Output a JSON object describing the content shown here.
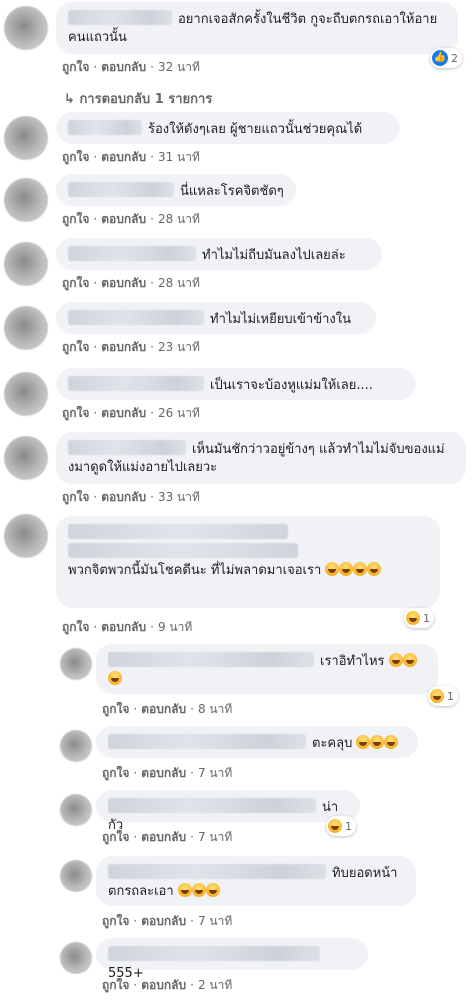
{
  "labels": {
    "like": "ถูกใจ",
    "reply": "ตอบกลับ",
    "dot": "·"
  },
  "replies_link": "การตอบกลับ 1 รายการ",
  "comments": [
    {
      "text": "อยากเจอสักครั้งในชีวิต กูจะถีบตกรถเอาให้อายคนแถวนั้น",
      "time": "32 นาที",
      "reaction_count": "2",
      "reaction": "like-icon"
    },
    {
      "text": "ร้องให้ดังๆเลย ผู้ชายแถวนั้นช่วยคุณได้",
      "time": "31 นาที"
    },
    {
      "text": "นี่แหละโรคจิตชัดๆ",
      "time": "28 นาที"
    },
    {
      "text": "ทำไมไม่ถีบมันลงไปเลยล่ะ",
      "time": "28 นาที"
    },
    {
      "text": "ทำไมไม่เหยียบเข้าข้างใน",
      "time": "23 นาที"
    },
    {
      "text": "เป็นเราจะบ้องหูแม่มให้เลย....",
      "time": "26 นาที"
    },
    {
      "text": "เห็นมันชักว่าวอยู่ข้างๆ แล้วทำไมไม่จับของแม่งมาดูดให้แม่งอายไปเลยวะ",
      "time": "33 นาที"
    },
    {
      "text": "พวกจิตพวกนี้มันโชคดีนะ ที่ไม่พลาดมาเจอเรา",
      "time": "9 นาที",
      "reaction_count": "1",
      "reaction": "haha-icon"
    },
    {
      "text": "เราอิทำไหร",
      "time": "8 นาที",
      "reaction_count": "1",
      "reaction": "haha-icon"
    },
    {
      "text": "ตะคลุบ",
      "time": "7 นาที"
    },
    {
      "text": "น่ากัว",
      "time": "7 นาที",
      "reaction_count": "1",
      "reaction": "haha-icon"
    },
    {
      "text": "ทิบยอดหน้า ตกรถละเอา",
      "time": "7 นาที"
    },
    {
      "text": "555+",
      "time": "2 นาที"
    }
  ]
}
